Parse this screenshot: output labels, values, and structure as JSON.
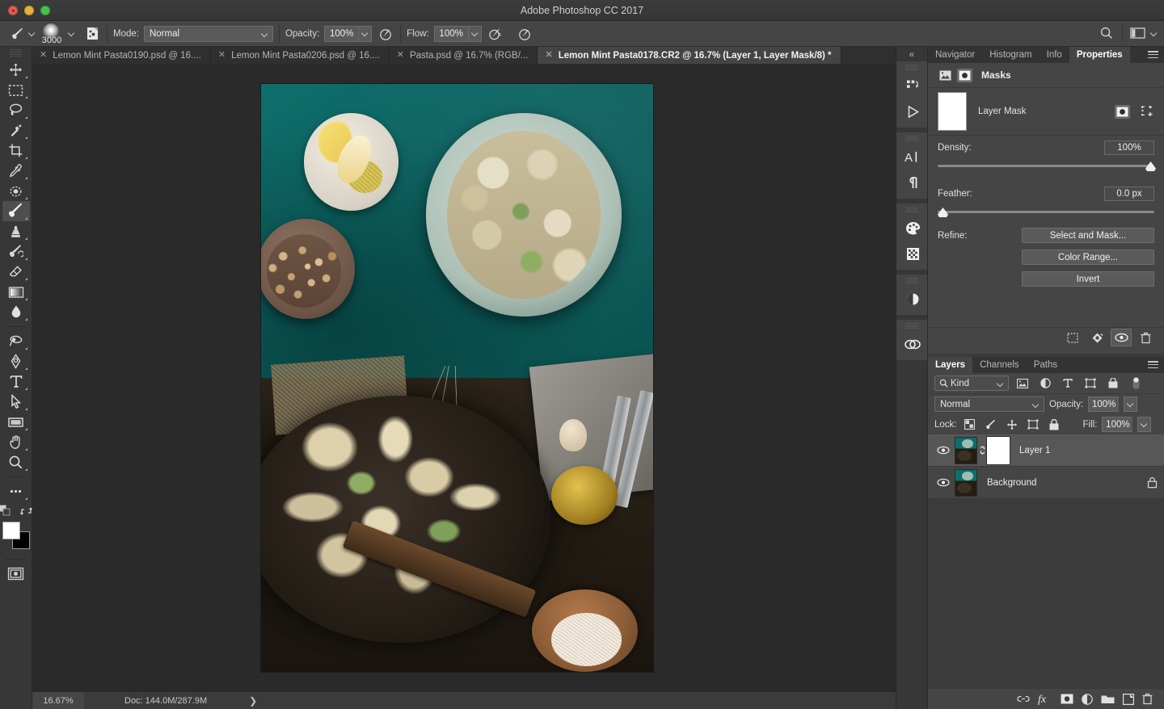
{
  "window": {
    "title": "Adobe Photoshop CC 2017",
    "traffic_lights": [
      "close-red",
      "minimize-yellow",
      "zoom-green"
    ]
  },
  "options_bar": {
    "tool_icon": "brush-icon",
    "brush_size": "3000",
    "toggle_brush_panel_icon": "brush-panel-icon",
    "mode_label": "Mode:",
    "mode_value": "Normal",
    "opacity_label": "Opacity:",
    "opacity_value": "100%",
    "opacity_pressure_icon": "pressure-opacity-icon",
    "flow_label": "Flow:",
    "flow_value": "100%",
    "airbrush_icon": "airbrush-icon",
    "smoothing_icon": "pressure-size-icon",
    "search_icon": "search-icon",
    "workspace_icon": "workspace-switcher-icon"
  },
  "tabs": [
    {
      "label": "Lemon Mint Pasta0190.psd @ 16....",
      "active": false
    },
    {
      "label": "Lemon Mint Pasta0206.psd @ 16....",
      "active": false
    },
    {
      "label": "Pasta.psd @ 16.7% (RGB/...",
      "active": false
    },
    {
      "label": "Lemon Mint Pasta0178.CR2 @ 16.7% (Layer 1, Layer Mask/8) *",
      "active": true
    }
  ],
  "toolbar": {
    "tools": [
      {
        "name": "move-tool",
        "selected": false
      },
      {
        "name": "rectangular-marquee-tool",
        "selected": false
      },
      {
        "name": "lasso-tool",
        "selected": false
      },
      {
        "name": "quick-selection-tool",
        "selected": false
      },
      {
        "name": "crop-tool",
        "selected": false
      },
      {
        "name": "eyedropper-tool",
        "selected": false
      },
      {
        "name": "spot-healing-brush-tool",
        "selected": false
      },
      {
        "name": "brush-tool",
        "selected": true
      },
      {
        "name": "clone-stamp-tool",
        "selected": false
      },
      {
        "name": "history-brush-tool",
        "selected": false
      },
      {
        "name": "eraser-tool",
        "selected": false
      },
      {
        "name": "gradient-tool",
        "selected": false
      },
      {
        "name": "blur-tool",
        "selected": false
      },
      {
        "name": "dodge-tool",
        "selected": false
      },
      {
        "name": "pen-tool",
        "selected": false
      },
      {
        "name": "horizontal-type-tool",
        "selected": false
      },
      {
        "name": "path-selection-tool",
        "selected": false
      },
      {
        "name": "rectangle-tool",
        "selected": false
      },
      {
        "name": "hand-tool",
        "selected": false
      },
      {
        "name": "zoom-tool",
        "selected": false
      },
      {
        "name": "edit-toolbar-tool",
        "selected": false
      }
    ],
    "quick-mask-icon": "quick-mask-mode-icon",
    "swap-colors-icon": "swap-colors-icon",
    "default-colors-icon": "default-colors-icon",
    "screen-mode-icon": "screen-mode-icon",
    "foreground_color": "#ffffff",
    "background_color": "#000000"
  },
  "icon_dock": {
    "collapse_icon": "collapse-panels-icon",
    "groups": [
      [
        "history-icon",
        "actions-icon"
      ],
      [
        "character-icon",
        "paragraph-icon"
      ],
      [
        "color-icon",
        "swatches-icon"
      ],
      [
        "adjustments-icon"
      ],
      [
        "libraries-icon"
      ]
    ]
  },
  "properties_panel": {
    "tabs": [
      {
        "label": "Navigator",
        "active": false
      },
      {
        "label": "Histogram",
        "active": false
      },
      {
        "label": "Info",
        "active": false
      },
      {
        "label": "Properties",
        "active": true
      }
    ],
    "menu_icon": "panel-menu-icon",
    "mode_title": "Masks",
    "pixel_mask_icon": "pixel-mask-icon",
    "vector_mask_icon": "vector-mask-icon",
    "mask_name": "Layer Mask",
    "mask_select_icon": "load-selection-icon",
    "mask_vector_icon": "add-vector-mask-icon",
    "density_label": "Density:",
    "density_value": "100%",
    "density_pct": 100,
    "feather_label": "Feather:",
    "feather_value": "0.0 px",
    "feather_pct": 0,
    "refine_label": "Refine:",
    "buttons": [
      "Select and Mask...",
      "Color Range...",
      "Invert"
    ],
    "footer_icons": [
      {
        "name": "load-selection-from-mask-icon",
        "active": false
      },
      {
        "name": "apply-mask-icon",
        "active": false
      },
      {
        "name": "toggle-mask-visibility-icon",
        "active": true
      },
      {
        "name": "delete-mask-icon",
        "active": false
      }
    ]
  },
  "layers_panel": {
    "tabs": [
      {
        "label": "Layers",
        "active": true
      },
      {
        "label": "Channels",
        "active": false
      },
      {
        "label": "Paths",
        "active": false
      }
    ],
    "menu_icon": "panel-menu-icon",
    "filter_kind": "Kind",
    "filter_icons": [
      "filter-pixel-icon",
      "filter-adjustment-icon",
      "filter-type-icon",
      "filter-shape-icon",
      "filter-smart-object-icon",
      "filter-toggle-icon"
    ],
    "blend_mode": "Normal",
    "opacity_label": "Opacity:",
    "opacity_value": "100%",
    "lock_label": "Lock:",
    "lock_icons": [
      "lock-transparent-pixels-icon",
      "lock-image-pixels-icon",
      "lock-position-icon",
      "lock-artboard-nesting-icon",
      "lock-all-icon"
    ],
    "fill_label": "Fill:",
    "fill_value": "100%",
    "layers": [
      {
        "name": "Layer 1",
        "selected": true,
        "visible": true,
        "has_mask": true,
        "linked": true,
        "locked": false
      },
      {
        "name": "Background",
        "selected": false,
        "visible": true,
        "has_mask": false,
        "linked": false,
        "locked": true
      }
    ],
    "footer_icons": [
      "link-layers-icon",
      "layer-style-fx-icon",
      "add-layer-mask-icon",
      "new-adjustment-layer-icon",
      "new-group-icon",
      "new-layer-icon",
      "delete-layer-icon"
    ]
  },
  "status_bar": {
    "zoom": "16.67%",
    "doc_info": "Doc: 144.0M/287.9M",
    "expand_icon": "chevron-right-icon"
  },
  "canvas": {
    "document_description": "Overhead food photograph: grilled zucchini pasta in a teal ceramic bowl on a dark teal table, a small white dish of lemon wedges and zest, a brown bowl of pine nuts, a cast iron skillet of pasta with wooden spoon, linen napkin with forks, olive oil cruet and a wooden bowl of grated cheese"
  }
}
